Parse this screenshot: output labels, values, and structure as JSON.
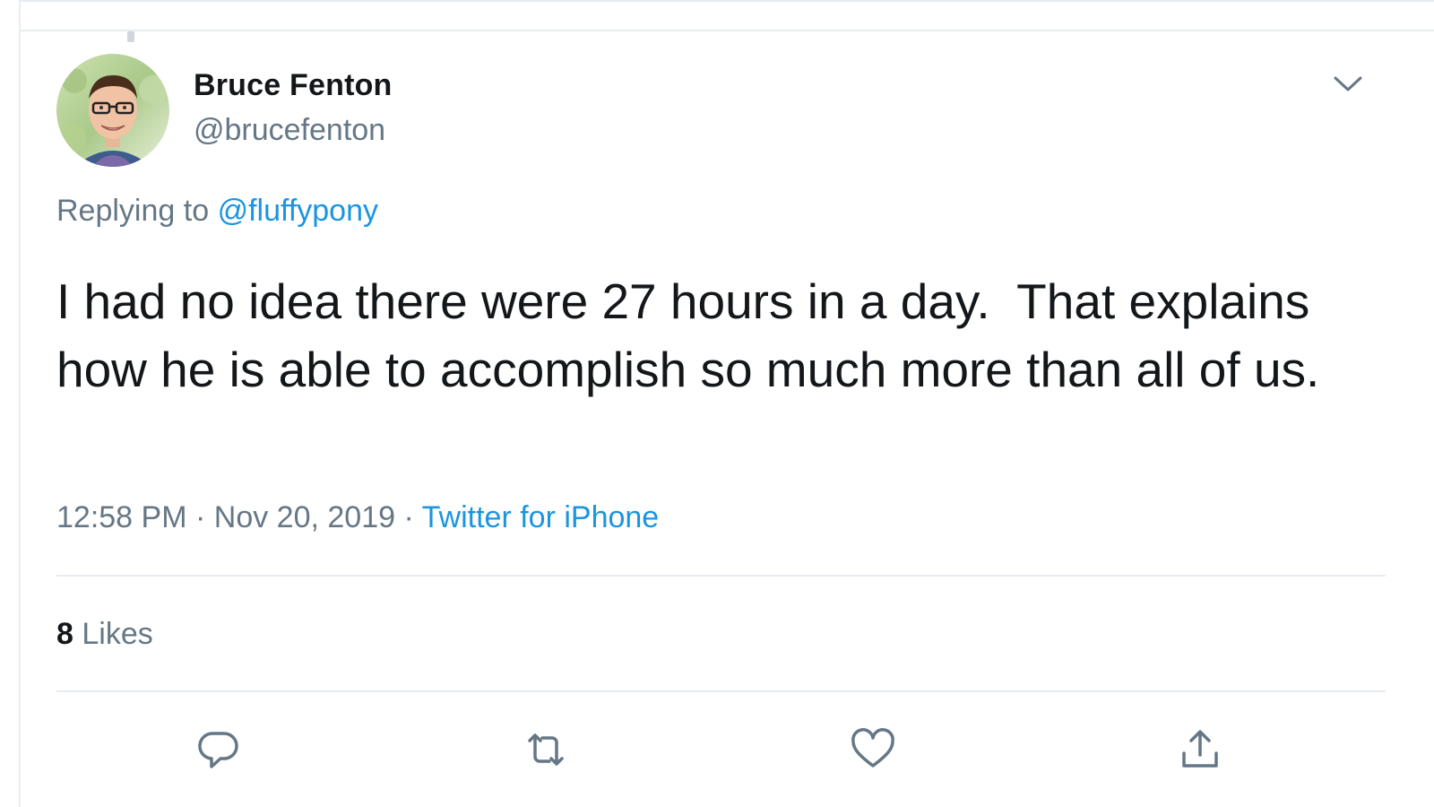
{
  "tweet": {
    "author": {
      "name": "Bruce Fenton",
      "handle": "@brucefenton"
    },
    "replying_prefix": "Replying to",
    "replying_to": "@fluffypony",
    "text": "I had no idea there were 27 hours in a day.  That explains how he is able to accomplish so much more than all of us.",
    "time": "12:58 PM",
    "separator": "·",
    "date": "Nov 20, 2019",
    "source": "Twitter for iPhone",
    "likes_count": "8",
    "likes_label": "Likes"
  },
  "icons": {
    "menu": "chevron-down-icon",
    "reply": "reply-icon",
    "retweet": "retweet-icon",
    "like": "heart-icon",
    "share": "share-icon"
  },
  "colors": {
    "link": "#1b95e0",
    "secondary_text": "#657786",
    "primary_text": "#14171a",
    "border": "#e6ecf0"
  }
}
